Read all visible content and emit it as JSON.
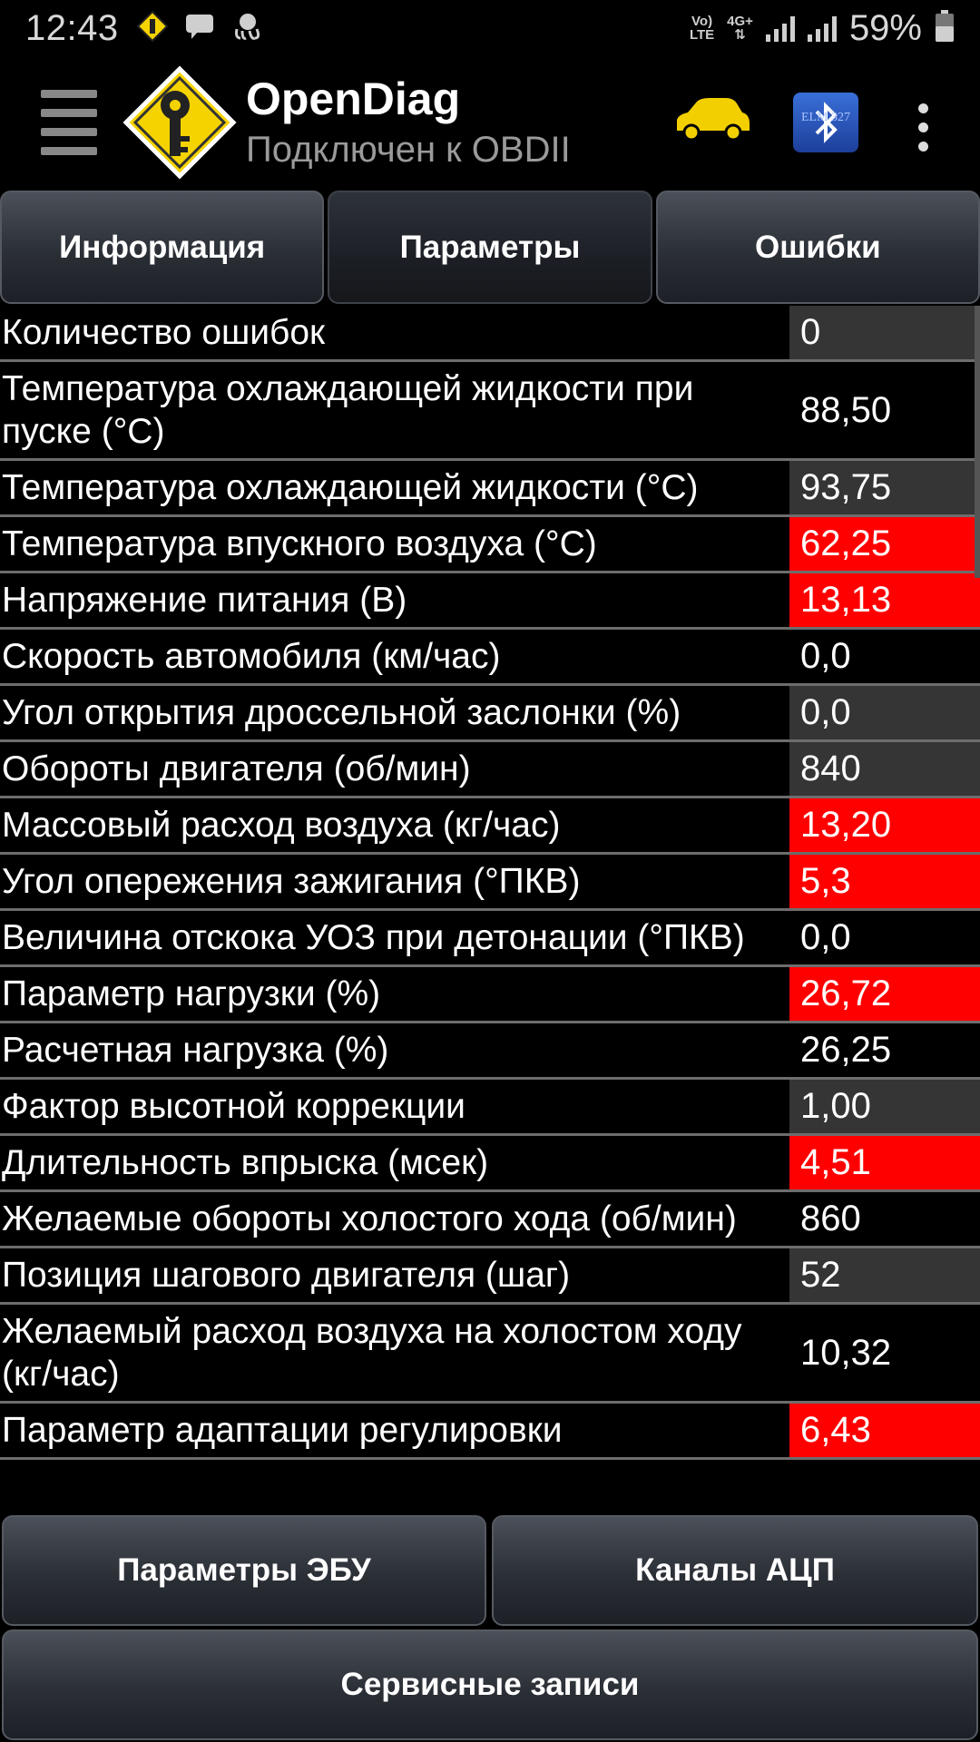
{
  "status_bar": {
    "time": "12:43",
    "network_top": "Vo)",
    "network_bottom": "LTE",
    "network_type": "4G+",
    "battery": "59%",
    "icons": [
      "key-warning-icon",
      "message-icon",
      "octopus-icon",
      "signal-icon",
      "battery-icon"
    ]
  },
  "app_bar": {
    "title": "OpenDiag",
    "subtitle": "Подключен к OBDII",
    "bt_badge": "ELM 327"
  },
  "tabs": [
    {
      "label": "Информация",
      "active": false
    },
    {
      "label": "Параметры",
      "active": true
    },
    {
      "label": "Ошибки",
      "active": false
    }
  ],
  "parameters": [
    {
      "label": "Количество ошибок",
      "value": "0",
      "state": "gray"
    },
    {
      "label": "Температура охлаждающей жидкости при пуске (°C)",
      "value": "88,50",
      "state": "black"
    },
    {
      "label": "Температура охлаждающей жидкости (°C)",
      "value": "93,75",
      "state": "gray"
    },
    {
      "label": "Температура впускного воздуха (°C)",
      "value": "62,25",
      "state": "red"
    },
    {
      "label": "Напряжение питания (В)",
      "value": "13,13",
      "state": "red"
    },
    {
      "label": "Скорость автомобиля (км/час)",
      "value": "0,0",
      "state": "black"
    },
    {
      "label": "Угол открытия дроссельной заслонки (%)",
      "value": "0,0",
      "state": "gray"
    },
    {
      "label": "Обороты двигателя (об/мин)",
      "value": "840",
      "state": "gray"
    },
    {
      "label": "Массовый расход воздуха (кг/час)",
      "value": "13,20",
      "state": "red"
    },
    {
      "label": "Угол опережения зажигания (°ПКВ)",
      "value": "5,3",
      "state": "red"
    },
    {
      "label": "Величина отскока УОЗ при детонации (°ПКВ)",
      "value": "0,0",
      "state": "black"
    },
    {
      "label": "Параметр нагрузки (%)",
      "value": "26,72",
      "state": "red"
    },
    {
      "label": "Расчетная нагрузка (%)",
      "value": "26,25",
      "state": "black"
    },
    {
      "label": "Фактор высотной коррекции",
      "value": "1,00",
      "state": "gray"
    },
    {
      "label": "Длительность впрыска (мсек)",
      "value": "4,51",
      "state": "red"
    },
    {
      "label": "Желаемые обороты холостого хода (об/мин)",
      "value": "860",
      "state": "black"
    },
    {
      "label": "Позиция шагового двигателя (шаг)",
      "value": "52",
      "state": "gray"
    },
    {
      "label": "Желаемый расход воздуха на холостом ходу (кг/час)",
      "value": "10,32",
      "state": "black"
    },
    {
      "label": "Параметр адаптации регулировки",
      "value": "6,43",
      "state": "red"
    }
  ],
  "bottom_buttons": {
    "ecu_params": "Параметры ЭБУ",
    "adc_channels": "Каналы АЦП",
    "service_records": "Сервисные записи"
  },
  "colors": {
    "alert_red": "#ff0000",
    "row_gray": "#353535",
    "logo_yellow": "#f5d300",
    "car_yellow": "#f2cf00"
  }
}
